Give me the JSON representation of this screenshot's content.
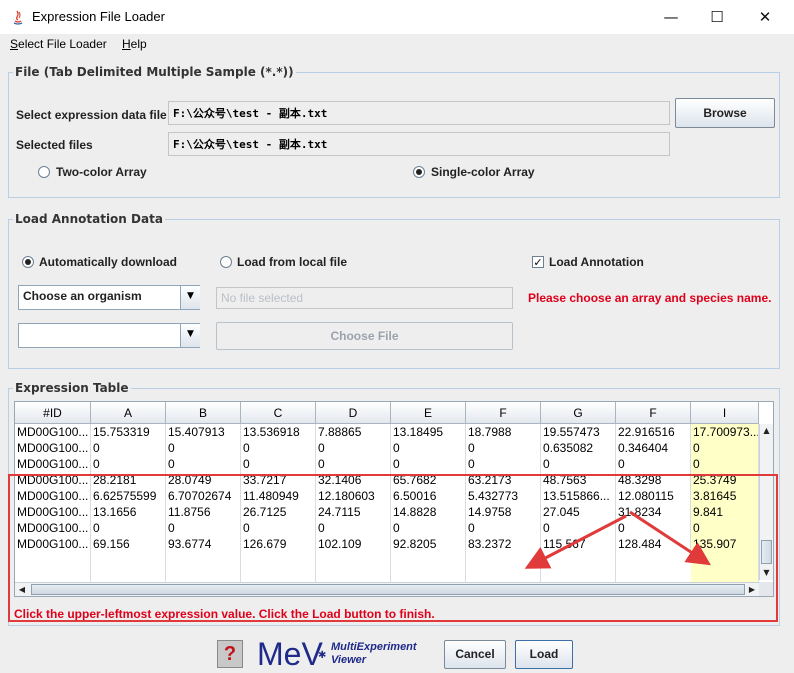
{
  "window": {
    "title": "Expression File Loader",
    "minimize_glyph": "—",
    "maximize_glyph": "☐",
    "close_glyph": "✕"
  },
  "menu": {
    "select_file_loader": {
      "accel": "S",
      "rest": "elect File Loader"
    },
    "help": {
      "accel": "H",
      "rest": "elp"
    }
  },
  "file_group": {
    "title": "File   (Tab Delimited Multiple Sample (*.*))",
    "select_label": "Select expression data file",
    "select_value": "F:\\公众号\\test - 副本.txt",
    "browse_label": "Browse",
    "selected_label": "Selected files",
    "selected_value": "F:\\公众号\\test - 副本.txt",
    "two_color_label": "Two-color Array",
    "single_color_label": "Single-color Array"
  },
  "annotation_group": {
    "title": "Load Annotation Data",
    "auto_download_label": "Automatically download",
    "local_file_label": "Load from local file",
    "load_annotation_label": "Load Annotation",
    "load_annotation_check": "✓",
    "organism_placeholder": "Choose an organism",
    "no_file_placeholder": "No file selected",
    "warning": "Please choose an array and species name.",
    "choose_file_label": "Choose File",
    "combo_arrow": "▼"
  },
  "expression_table": {
    "title": "Expression Table",
    "columns": [
      "#ID",
      "A",
      "B",
      "C",
      "D",
      "E",
      "F",
      "G",
      "F",
      "I"
    ],
    "rows": [
      [
        "MD00G100...",
        "15.753319",
        "15.407913",
        "13.536918",
        "7.88865",
        "13.18495",
        "18.7988",
        "19.557473",
        "22.916516",
        "17.700973..."
      ],
      [
        "MD00G100...",
        "0",
        "0",
        "0",
        "0",
        "0",
        "0",
        "0.635082",
        "0.346404",
        "0"
      ],
      [
        "MD00G100...",
        "0",
        "0",
        "0",
        "0",
        "0",
        "0",
        "0",
        "0",
        "0"
      ],
      [
        "MD00G100...",
        "28.2181",
        "28.0749",
        "33.7217",
        "32.1406",
        "65.7682",
        "63.2173",
        "48.7563",
        "48.3298",
        "25.3749"
      ],
      [
        "MD00G100...",
        "6.62575599",
        "6.70702674",
        "11.480949",
        "12.180603",
        "6.50016",
        "5.432773",
        "13.515866...",
        "12.080115",
        "3.81645"
      ],
      [
        "MD00G100...",
        "13.1656",
        "11.8756",
        "26.7125",
        "24.7115",
        "14.8828",
        "14.9758",
        "27.045",
        "31.8234",
        "9.841"
      ],
      [
        "MD00G100...",
        "0",
        "0",
        "0",
        "0",
        "0",
        "0",
        "0",
        "0",
        "0"
      ],
      [
        "MD00G100...",
        "69.156",
        "93.6774",
        "126.679",
        "102.109",
        "92.8205",
        "83.2372",
        "115.567",
        "128.484",
        "135.907"
      ]
    ],
    "instruction": "Click the upper-leftmost expression value. Click the Load button to finish.",
    "scroll_up": "▲",
    "scroll_down": "▼",
    "scroll_left": "◀",
    "scroll_right": "▶"
  },
  "footer": {
    "help_glyph": "?",
    "logo_main": "MeV",
    "logo_line1": "MultiExperiment",
    "logo_line2": "Viewer",
    "cancel_label": "Cancel",
    "load_label": "Load"
  },
  "colors": {
    "group_border": "#b8cfe5",
    "warning_red": "#e0001a",
    "annotation_red": "#e03a3a",
    "highlight_yellow": "#ffffc8",
    "logo_blue": "#1f2a8a"
  }
}
